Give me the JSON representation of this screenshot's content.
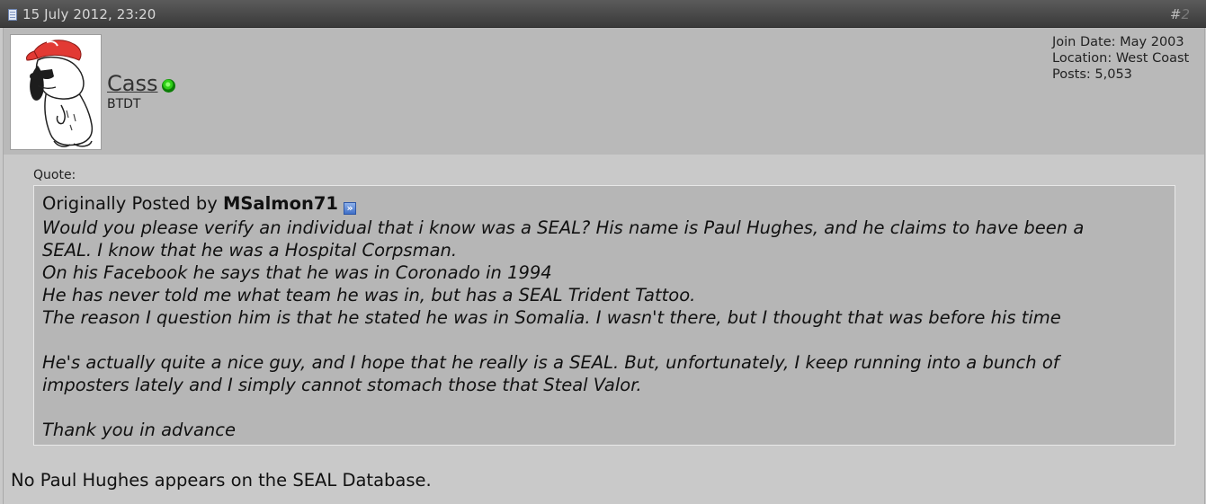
{
  "post": {
    "date": "15 July 2012, 23:20",
    "number_prefix": "#",
    "number": "2"
  },
  "user": {
    "name": "Cass",
    "title": "BTDT",
    "online_icon": "online-status-icon",
    "avatar_icon": "snoopy-avatar",
    "join_date": "Join Date: May 2003",
    "location": "Location: West Coast",
    "posts": "Posts: 5,053"
  },
  "quote": {
    "label": "Quote:",
    "posted_by_prefix": "Originally Posted by",
    "author": "MSalmon71",
    "view_post_icon": "view-post-icon",
    "lines": [
      "Would you please verify an individual that i know was a SEAL? His name is Paul Hughes, and he claims to have been a",
      "SEAL. I know that he was a Hospital Corpsman.",
      "On his Facebook he says that he was in Coronado in 1994",
      "He has never told me what team he was in, but has a SEAL Trident Tattoo.",
      "The reason I question him is that he stated he was in Somalia. I wasn't there, but I thought that was before his time",
      "",
      "He's actually quite a nice guy, and I hope that he really is a SEAL. But, unfortunately, I keep running into a bunch of",
      "imposters lately and I simply cannot stomach those that Steal Valor.",
      "",
      "Thank you in advance"
    ]
  },
  "reply": {
    "text": "No Paul Hughes appears on the SEAL Database."
  },
  "colors": {
    "header_bg": "#4a4a4a",
    "panel_bg": "#b9b9b9",
    "body_bg": "#c9c9c9",
    "quote_bg": "#b6b6b6",
    "online_green": "#2fcf18"
  }
}
